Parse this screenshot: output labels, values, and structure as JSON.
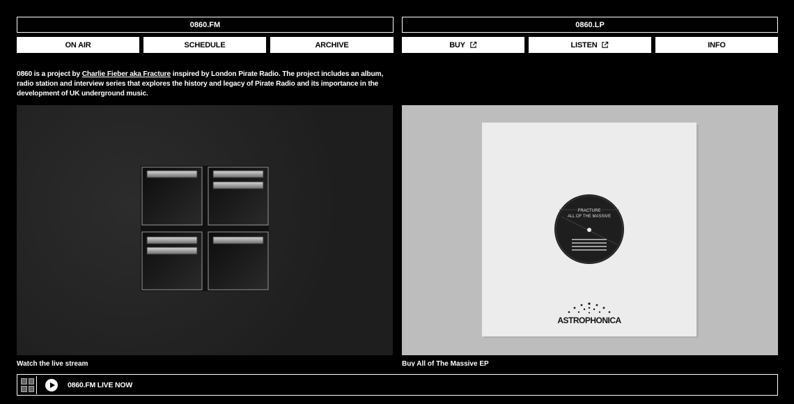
{
  "header": {
    "left_title": "0860.FM",
    "right_title": "0860.LP"
  },
  "nav": {
    "on_air": "ON AIR",
    "schedule": "SCHEDULE",
    "archive": "ARCHIVE",
    "buy": "BUY",
    "listen": "LISTEN",
    "info": "INFO"
  },
  "intro": {
    "text_before": "0860 is a project by ",
    "link": "Charlie Fieber aka Fracture",
    "text_after": " inspired by London Pirate Radio. The project includes an album, radio station and interview series that explores the history and legacy of Pirate Radio and its importance in the development of UK underground music."
  },
  "panels": {
    "left_caption": "Watch the live stream",
    "right_caption": "Buy All of The Massive EP",
    "record_label_artist": "FRACTURE",
    "record_label_title": "ALL OF THE MASSIVE",
    "sleeve_logo": "ASTROPHONICA"
  },
  "player": {
    "label": "0860.FM LIVE NOW"
  }
}
